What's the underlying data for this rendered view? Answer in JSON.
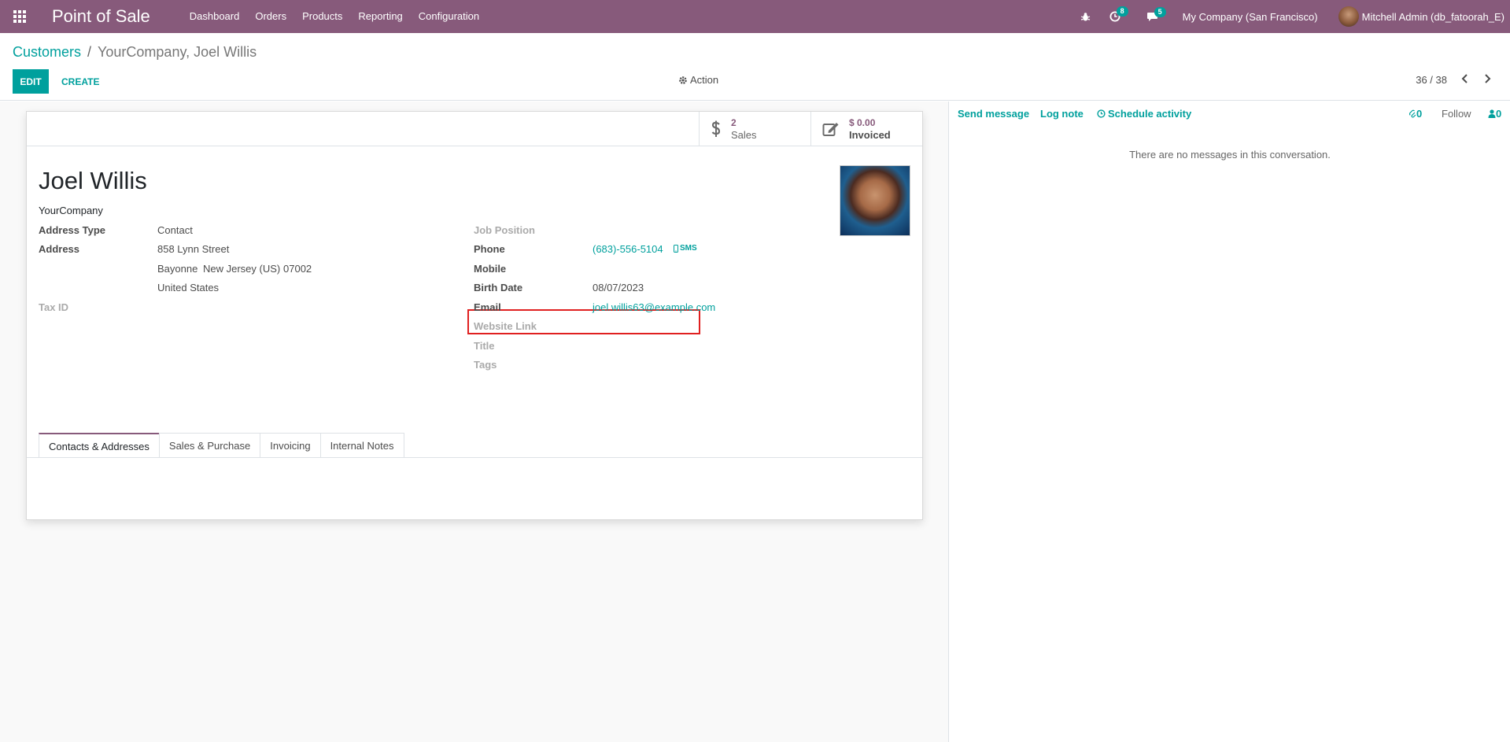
{
  "navbar": {
    "brand": "Point of Sale",
    "menu": [
      "Dashboard",
      "Orders",
      "Products",
      "Reporting",
      "Configuration"
    ],
    "activity_count": "8",
    "message_count": "5",
    "company": "My Company (San Francisco)",
    "user": "Mitchell Admin (db_fatoorah_E)"
  },
  "breadcrumb": {
    "parent": "Customers",
    "separator": "/",
    "current": "YourCompany, Joel Willis"
  },
  "toolbar": {
    "edit_label": "EDIT",
    "create_label": "CREATE",
    "action_label": "Action",
    "pager": "36 / 38"
  },
  "smart_buttons": {
    "sales_value": "2",
    "sales_label": "Sales",
    "invoiced_value": "$ 0.00",
    "invoiced_label": "Invoiced"
  },
  "partner": {
    "name": "Joel Willis",
    "company": "YourCompany"
  },
  "left_fields": {
    "address_type_label": "Address Type",
    "address_type_value": "Contact",
    "address_label": "Address",
    "street": "858 Lynn Street",
    "city": "Bayonne",
    "state": "New Jersey (US)",
    "zip": "07002",
    "country": "United States",
    "tax_id_label": "Tax ID"
  },
  "right_fields": {
    "job_position_label": "Job Position",
    "phone_label": "Phone",
    "phone_value": "(683)-556-5104",
    "sms_label": "SMS",
    "mobile_label": "Mobile",
    "birth_date_label": "Birth Date",
    "birth_date_value": "08/07/2023",
    "email_label": "Email",
    "email_value": "joel.willis63@example.com",
    "website_label": "Website Link",
    "title_label": "Title",
    "tags_label": "Tags"
  },
  "tabs": [
    "Contacts & Addresses",
    "Sales & Purchase",
    "Invoicing",
    "Internal Notes"
  ],
  "chatter": {
    "send_message": "Send message",
    "log_note": "Log note",
    "schedule_activity": "Schedule activity",
    "attachments_count": "0",
    "follow_label": "Follow",
    "followers_count": "0",
    "empty_text": "There are no messages in this conversation."
  },
  "colors": {
    "navbar": "#875a7b",
    "accent": "#00a09d",
    "highlight": "#e02020"
  }
}
